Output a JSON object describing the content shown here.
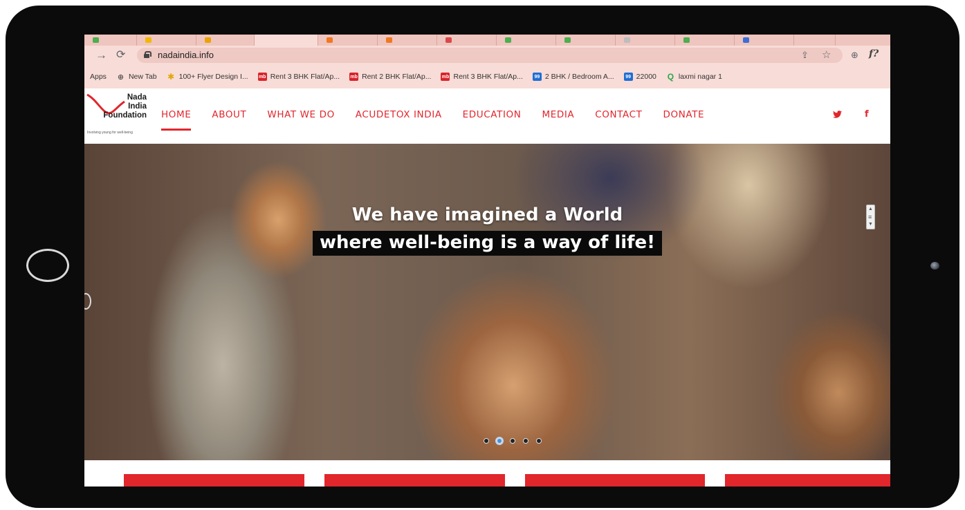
{
  "colors": {
    "brand_red": "#e1262c",
    "chrome_bar": "#f8dcd7",
    "tab_strip": "#efc5bf",
    "frame": "#0b0b0b"
  },
  "browser": {
    "url": "nadaindia.info",
    "back_icon": "back-arrow-icon",
    "reload_icon": "reload-icon",
    "bookmarks": [
      {
        "label": "Apps",
        "icon": "apps-icon"
      },
      {
        "label": "New Tab",
        "icon": "globe-icon"
      },
      {
        "label": "100+ Flyer Design I...",
        "icon": "flyer-icon"
      },
      {
        "label": "Rent 3 BHK Flat/Ap...",
        "icon": "mb-icon",
        "badge": "mb"
      },
      {
        "label": "Rent 2 BHK Flat/Ap...",
        "icon": "mb-icon",
        "badge": "mb"
      },
      {
        "label": "Rent 3 BHK Flat/Ap...",
        "icon": "mb-icon",
        "badge": "mb"
      },
      {
        "label": "2 BHK / Bedroom A...",
        "icon": "99-icon",
        "badge": "99"
      },
      {
        "label": "22000",
        "icon": "99-icon",
        "badge": "99"
      },
      {
        "label": "laxmi nagar 1",
        "icon": "quikr-icon",
        "badge": "Q"
      }
    ]
  },
  "site": {
    "logo": {
      "line1": "Nada",
      "line2": "India",
      "line3": "Foundation",
      "tagline": "Involving young for well-being"
    },
    "nav": [
      "HOME",
      "ABOUT",
      "WHAT WE DO",
      "ACUDETOX INDIA",
      "EDUCATION",
      "MEDIA",
      "CONTACT",
      "DONATE"
    ],
    "social": {
      "twitter": "twitter-icon",
      "facebook": "facebook-icon"
    }
  },
  "hero": {
    "line1": "We have imagined a World",
    "line2": "where well-being is a way of life!",
    "slides_total": 5,
    "active_slide": 2
  }
}
